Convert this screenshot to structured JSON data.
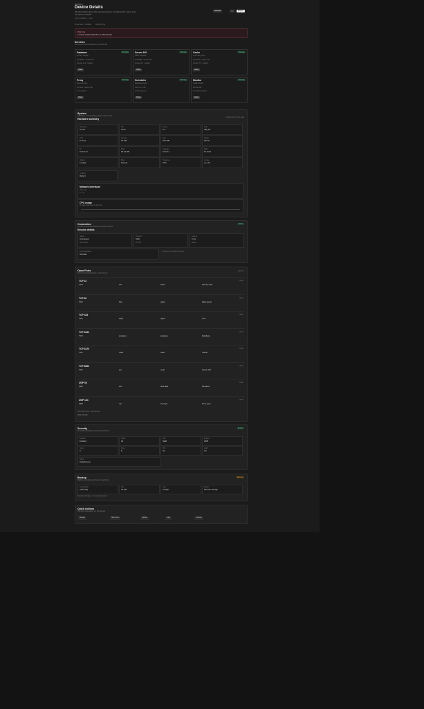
{
  "header": {
    "breadcrumb": "Devices /",
    "title": "Device Details",
    "desc_line1": "All information about the selected device, including OS, ports, and",
    "desc_line2": "connection details.",
    "updated": "Last updated · now",
    "btn_refresh": "Refresh",
    "btn_more": "···",
    "btn_export": "Export"
  },
  "subnav": {
    "left": "Overview · Details",
    "right": "Activity log"
  },
  "alert": {
    "title": "Warning",
    "text": "1 issue needs attention on this device"
  },
  "services": {
    "title": "Services",
    "subtitle": "Running services detected on this device",
    "cards": [
      {
        "name": "Database",
        "status": "Running",
        "line1": "Primary storage",
        "line2": "Port 5432 · uptime 12d",
        "line3": "Version 14.2 · healthy",
        "action": "Open"
      },
      {
        "name": "Server API",
        "status": "Running",
        "line1": "REST endpoint",
        "line2": "Port 8080 · uptime 12d",
        "line3": "Version 2.1 · healthy",
        "action": "Open"
      },
      {
        "name": "Cache",
        "status": "Running",
        "line1": "In-memory store",
        "line2": "Port 6379 · uptime 12d",
        "line3": "Version 7.0 · healthy",
        "action": "Open"
      },
      {
        "name": "Proxy",
        "status": "Running",
        "line1": "Reverse proxy",
        "line2": "Port 443 · uptime 12d",
        "line3": "TLS enabled",
        "action": "Open"
      },
      {
        "name": "Scheduler",
        "status": "Running",
        "line1": "Background jobs",
        "line2": "Next run in 4m",
        "line3": "12 jobs queued",
        "action": "Open"
      },
      {
        "name": "Monitor",
        "status": "Running",
        "line1": "Health checks",
        "line2": "Interval 30s",
        "line3": "All checks passing",
        "action": "Open"
      }
    ]
  },
  "system": {
    "title": "System",
    "subtitle": "Hardware and operating system information",
    "meta": "Collected 2 min ago",
    "sub2": "Hardware summary",
    "cells": [
      {
        "label": "Hostname",
        "value": "srv-01"
      },
      {
        "label": "OS",
        "value": "Linux"
      },
      {
        "label": "Kernel",
        "value": "6.1"
      },
      {
        "label": "Arch",
        "value": "x86_64"
      },
      {
        "label": "CPU",
        "value": "8 cores"
      },
      {
        "label": "Memory",
        "value": "32 GB"
      },
      {
        "label": "Disk",
        "value": "512 GB"
      },
      {
        "label": "Model",
        "value": "Server"
      },
      {
        "label": "IP",
        "value": "10.0.0.12"
      },
      {
        "label": "MAC",
        "value": "00:1A:2B"
      },
      {
        "label": "Gateway",
        "value": "10.0.0.1"
      },
      {
        "label": "DNS",
        "value": "10.0.0.2"
      },
      {
        "label": "Uptime",
        "value": "12 days"
      },
      {
        "label": "Boot",
        "value": "Normal"
      },
      {
        "label": "Timezone",
        "value": "UTC"
      },
      {
        "label": "Locale",
        "value": "en_US"
      }
    ],
    "extra_label": "Location",
    "extra_value": "Rack 4",
    "block1_title": "Network interfaces",
    "block1_line1": "eth0 · up",
    "block1_line2": "lo · up",
    "block2_title": "CPU usage",
    "block2_line": "Average load over the last hour"
  },
  "connection": {
    "title": "Connection",
    "badge": "Online",
    "subtitle": "Current connection state and session details",
    "detail": "Session details",
    "cells": [
      {
        "label": "Status",
        "value": "Connected",
        "sub": "Since 09:12"
      },
      {
        "label": "Protocol",
        "value": "SSH",
        "sub": "Port 22"
      },
      {
        "label": "Latency",
        "value": "4 ms",
        "sub": "Stable"
      }
    ],
    "foot_label": "Last handshake",
    "foot_value": "Success",
    "foot_note": "No errors in the last 24 hours"
  },
  "ports": {
    "title": "Open Ports",
    "subtitle": "Ports currently listening on this device",
    "meta": "8 ports",
    "rows": [
      {
        "name": "TCP 22",
        "state": "Open",
        "proto": "TCP",
        "svc": "ssh",
        "proc": "sshd",
        "note": "Secure shell"
      },
      {
        "name": "TCP 80",
        "state": "Open",
        "proto": "TCP",
        "svc": "http",
        "proc": "nginx",
        "note": "Web server"
      },
      {
        "name": "TCP 443",
        "state": "Open",
        "proto": "TCP",
        "svc": "https",
        "proc": "nginx",
        "note": "TLS"
      },
      {
        "name": "TCP 5432",
        "state": "Open",
        "proto": "TCP",
        "svc": "postgres",
        "proc": "postgres",
        "note": "Database"
      },
      {
        "name": "TCP 6379",
        "state": "Open",
        "proto": "TCP",
        "svc": "redis",
        "proc": "redis",
        "note": "Cache"
      },
      {
        "name": "TCP 8080",
        "state": "Open",
        "proto": "TCP",
        "svc": "api",
        "proc": "node",
        "note": "Server API"
      },
      {
        "name": "UDP 53",
        "state": "Open",
        "proto": "UDP",
        "svc": "dns",
        "proc": "dnsmasq",
        "note": "Resolver"
      },
      {
        "name": "UDP 123",
        "state": "Open",
        "proto": "UDP",
        "svc": "ntp",
        "proc": "chronyd",
        "note": "Time sync"
      }
    ],
    "footer": "Scanned 8 ports · all expected",
    "footer2": "View full scan"
  },
  "security": {
    "title": "Security",
    "badge": "Secure",
    "subtitle": "Firewall, certificates and access policies",
    "cells": [
      {
        "label": "Firewall",
        "value": "Enabled"
      },
      {
        "label": "Rules",
        "value": "24"
      },
      {
        "label": "SSL",
        "value": "Valid"
      },
      {
        "label": "Expires",
        "value": "2025"
      },
      {
        "label": "Users",
        "value": "3"
      },
      {
        "label": "Keys",
        "value": "5"
      },
      {
        "label": "2FA",
        "value": "On"
      },
      {
        "label": "Audit",
        "value": "On"
      }
    ],
    "wide_label": "Policy",
    "wide_value": "Default deny"
  },
  "backup": {
    "title": "Backup",
    "badge": "Warning",
    "subtitle": "Backup schedule and recent snapshots",
    "cells": [
      {
        "label": "Last backup",
        "value": "Yesterday"
      },
      {
        "label": "Size",
        "value": "42 GB"
      },
      {
        "label": "Next",
        "value": "Tonight"
      },
      {
        "label": "Target",
        "value": "Remote storage"
      }
    ],
    "note": "Retention 30 days · 14 snapshots stored"
  },
  "actions": {
    "title": "Quick Actions",
    "subtitle": "Common operations for this device",
    "chips": [
      "Restart",
      "Shut down",
      "Update",
      "Logs",
      "Console"
    ]
  }
}
